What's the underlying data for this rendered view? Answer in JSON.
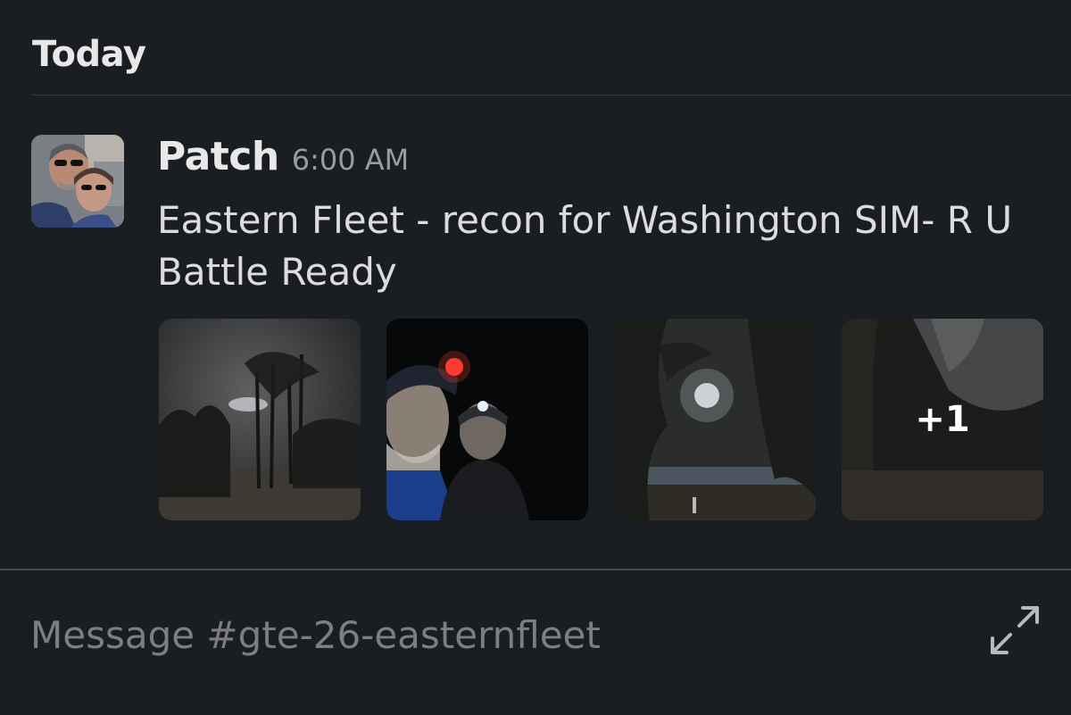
{
  "day_header": "Today",
  "message": {
    "sender": "Patch",
    "time": "6:00 AM",
    "text": "Eastern Fleet - recon for Washington SIM- R U Battle Ready",
    "avatar_icon": "couple-selfie-avatar",
    "attachments": [
      {
        "icon": "night-trees-photo"
      },
      {
        "icon": "headlamp-selfie-photo"
      },
      {
        "icon": "moonlit-lake-photo"
      },
      {
        "icon": "dark-trail-photo",
        "more_label": "+1"
      }
    ]
  },
  "composer": {
    "placeholder": "Message #gte-26-easternfleet",
    "expand_icon": "expand-icon"
  },
  "colors": {
    "background": "#1a1d21",
    "text": "#d1d2d3",
    "muted": "#9a9b9d",
    "divider": "#34363a"
  }
}
